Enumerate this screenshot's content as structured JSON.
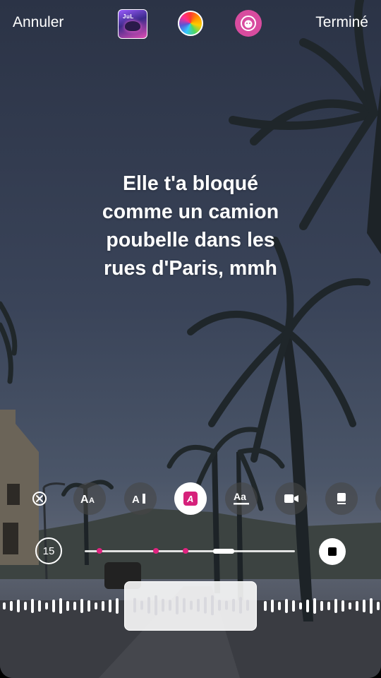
{
  "header": {
    "cancel_label": "Annuler",
    "done_label": "Terminé",
    "album_art_text": "JuL"
  },
  "lyrics": {
    "lines": [
      "Elle t'a bloqué",
      "comme un camion",
      "poubelle dans les",
      "rues d'Paris, mmh"
    ]
  },
  "toolbar": {
    "tools": [
      {
        "name": "remove-lyrics",
        "icon": "close-circle-icon"
      },
      {
        "name": "font-size-style",
        "icon": "text-size-icon"
      },
      {
        "name": "typewriter-style",
        "icon": "text-cursor-icon"
      },
      {
        "name": "highlight-style",
        "icon": "highlighted-a-icon",
        "active": true
      },
      {
        "name": "underline-style",
        "icon": "underlined-aa-icon"
      },
      {
        "name": "video-style",
        "icon": "video-icon"
      },
      {
        "name": "card-style",
        "icon": "card-icon"
      }
    ]
  },
  "player": {
    "duration_label": "15",
    "timeline_marker_fractions": [
      0.07,
      0.34,
      0.48
    ],
    "playhead_fraction": 0.66
  },
  "colors": {
    "accent": "#d6217b",
    "effect_button": "#d84c9f"
  }
}
